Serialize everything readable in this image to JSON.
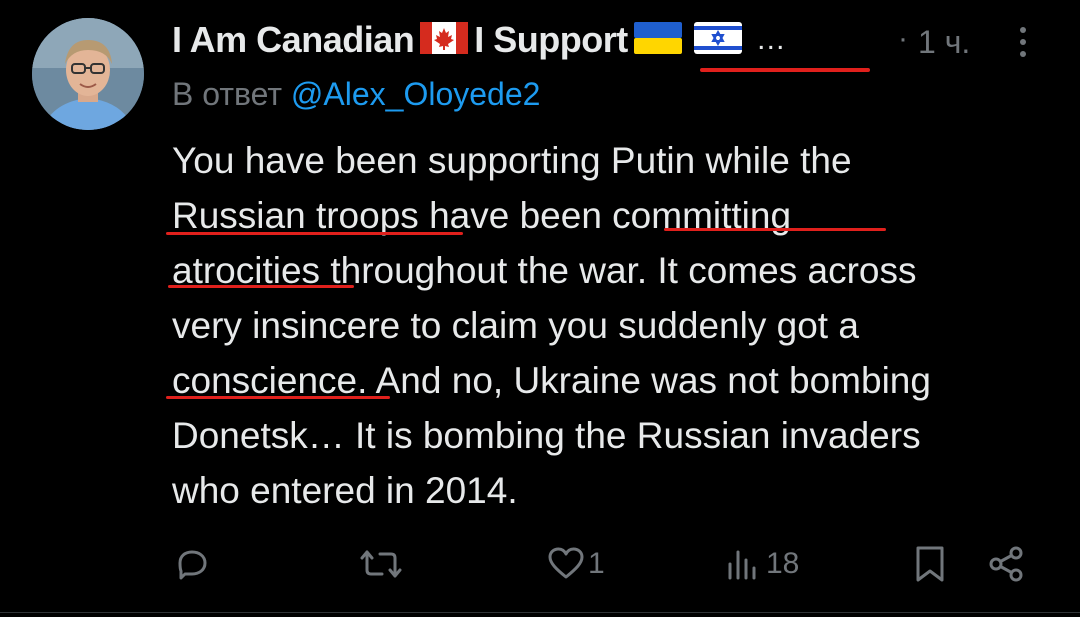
{
  "author": {
    "display_name_part1": "I Am Canadian",
    "display_name_part2": "I Support",
    "ellipsis": "…",
    "flags": [
      "canada-flag-icon",
      "ukraine-flag-icon",
      "israel-flag-icon"
    ],
    "avatar": "avatar-photo"
  },
  "meta": {
    "dot": "·",
    "time": "1 ч."
  },
  "reply": {
    "prefix": "В ответ",
    "handle": "@Alex_Oloyede2"
  },
  "tweet": {
    "lines": [
      "You have been supporting Putin while the",
      "Russian troops have been committing",
      "atrocities throughout the war. It comes across",
      "very insincere to claim you suddenly got a",
      "conscience. And no, Ukraine was not bombing",
      "Donetsk… It is bombing the Russian invaders",
      "who entered in 2014."
    ]
  },
  "actions": {
    "reply_count": "",
    "retweet_count": "",
    "like_count": "1",
    "views_count": "18"
  },
  "colors": {
    "background": "#000000",
    "text": "#e7e9ea",
    "muted": "#71767b",
    "link": "#1d9bf0",
    "annotation_red": "#e0201c"
  }
}
